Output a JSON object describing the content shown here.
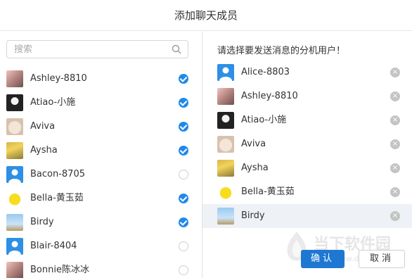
{
  "dialog": {
    "title": "添加聊天成员",
    "search": {
      "placeholder": "搜索",
      "value": ""
    },
    "hint": "请选择要发送消息的分机用户！",
    "ok_label": "确认",
    "cancel_label": "取消"
  },
  "contacts": [
    {
      "name": "Ashley-8810",
      "avatar": "photo-a",
      "checked": true
    },
    {
      "name": "Atiao-小施",
      "avatar": "photo-b",
      "checked": true
    },
    {
      "name": "Aviva",
      "avatar": "photo-c",
      "checked": true
    },
    {
      "name": "Aysha",
      "avatar": "photo-d",
      "checked": true
    },
    {
      "name": "Bacon-8705",
      "avatar": "default-user",
      "checked": false
    },
    {
      "name": "Bella-黄玉茹",
      "avatar": "photo-e",
      "checked": true
    },
    {
      "name": "Birdy",
      "avatar": "photo-f",
      "checked": true
    },
    {
      "name": "Blair-8404",
      "avatar": "default-user",
      "checked": false
    },
    {
      "name": "Bonnie陈冰冰",
      "avatar": "photo-a",
      "checked": false
    }
  ],
  "selected": [
    {
      "name": "Alice-8803",
      "avatar": "default-user"
    },
    {
      "name": "Ashley-8810",
      "avatar": "photo-a"
    },
    {
      "name": "Atiao-小施",
      "avatar": "photo-b"
    },
    {
      "name": "Aviva",
      "avatar": "photo-c"
    },
    {
      "name": "Aysha",
      "avatar": "photo-d"
    },
    {
      "name": "Bella-黄玉茹",
      "avatar": "photo-e"
    },
    {
      "name": "Birdy",
      "avatar": "photo-f"
    }
  ],
  "watermark": {
    "text": "当下软件园",
    "url": "www.downxia.com"
  },
  "colors": {
    "accent": "#1f8ae8",
    "primary_button": "#1e78d2",
    "hover_row": "#eef1f6"
  }
}
